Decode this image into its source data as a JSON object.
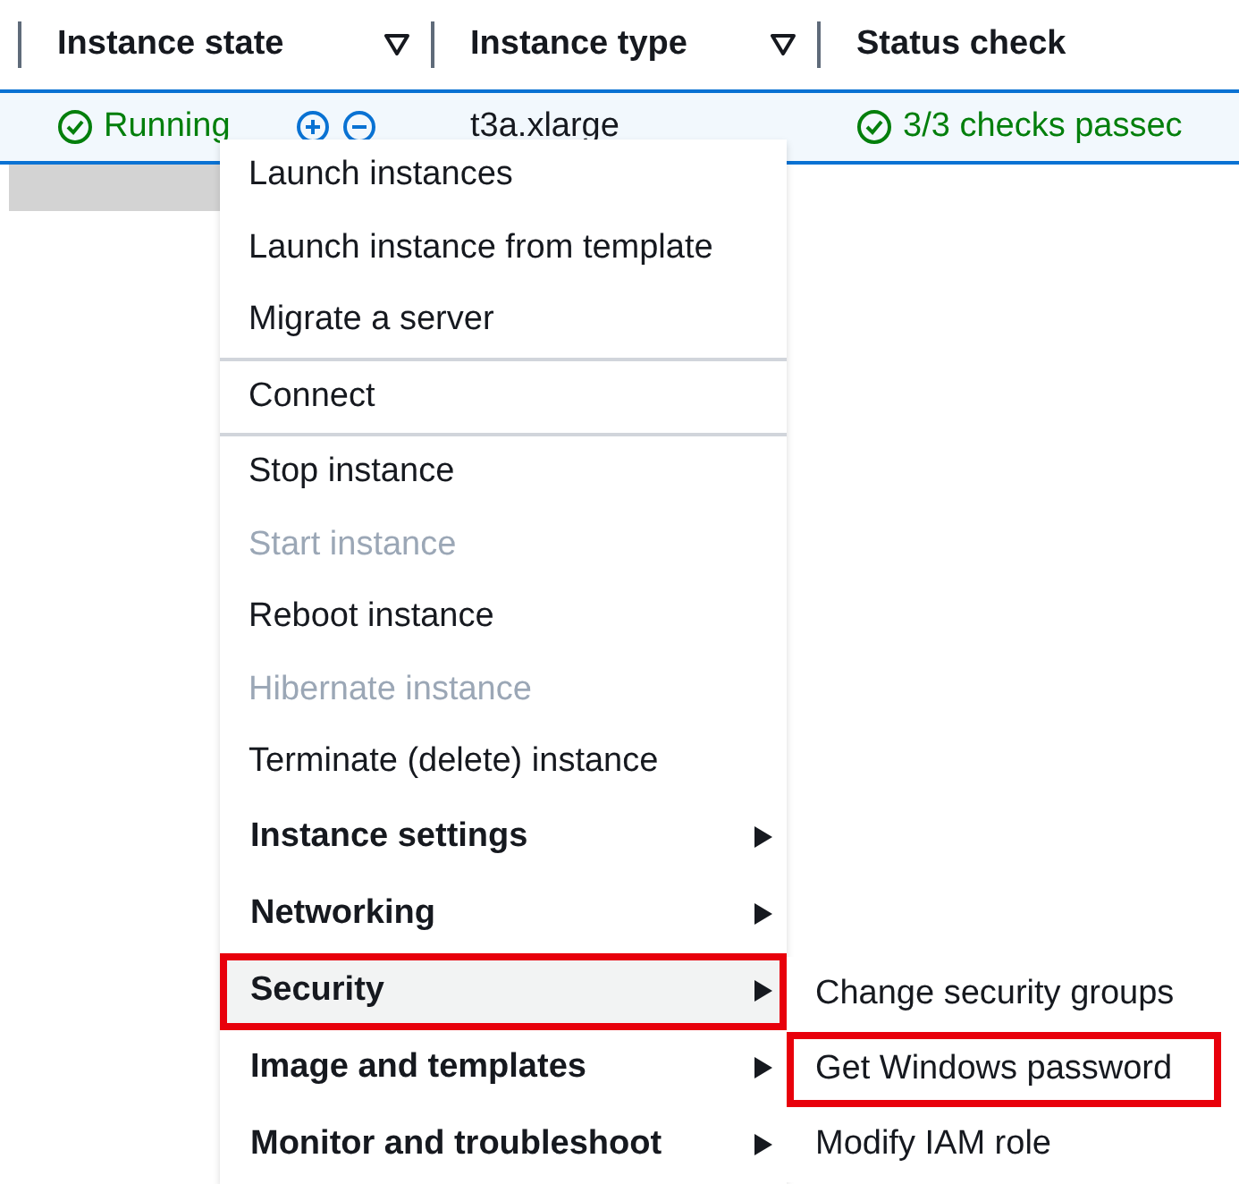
{
  "table": {
    "columns": [
      {
        "label": "Instance state",
        "filter": true
      },
      {
        "label": "Instance type",
        "filter": true
      },
      {
        "label": "Status check",
        "filter": false
      }
    ],
    "row": {
      "selected": true,
      "state": "Running",
      "type": "t3a.xlarge",
      "status": "3/3 checks passec"
    }
  },
  "menu": {
    "groups": [
      {
        "items": [
          {
            "label": "Launch instances",
            "kind": "action",
            "disabled": false
          },
          {
            "label": "Launch instance from template",
            "kind": "action",
            "disabled": false
          },
          {
            "label": "Migrate a server",
            "kind": "action",
            "disabled": false
          }
        ]
      },
      {
        "items": [
          {
            "label": "Connect",
            "kind": "action",
            "disabled": false
          }
        ]
      },
      {
        "items": [
          {
            "label": "Stop instance",
            "kind": "action",
            "disabled": false
          },
          {
            "label": "Start instance",
            "kind": "action",
            "disabled": true
          },
          {
            "label": "Reboot instance",
            "kind": "action",
            "disabled": false
          },
          {
            "label": "Hibernate instance",
            "kind": "action",
            "disabled": true
          },
          {
            "label": "Terminate (delete) instance",
            "kind": "action",
            "disabled": false
          },
          {
            "label": "Instance settings",
            "kind": "submenu",
            "selected": false,
            "annotated": false
          },
          {
            "label": "Networking",
            "kind": "submenu",
            "selected": false,
            "annotated": false
          },
          {
            "label": "Security",
            "kind": "submenu",
            "selected": true,
            "annotated": true
          },
          {
            "label": "Image and templates",
            "kind": "submenu",
            "selected": false,
            "annotated": false
          },
          {
            "label": "Monitor and troubleshoot",
            "kind": "submenu",
            "selected": false,
            "annotated": false
          }
        ]
      }
    ]
  },
  "submenu": {
    "items": [
      {
        "label": "Change security groups",
        "annotated": false
      },
      {
        "label": "Get Windows password",
        "annotated": true
      },
      {
        "label": "Modify IAM role",
        "annotated": false
      }
    ]
  }
}
